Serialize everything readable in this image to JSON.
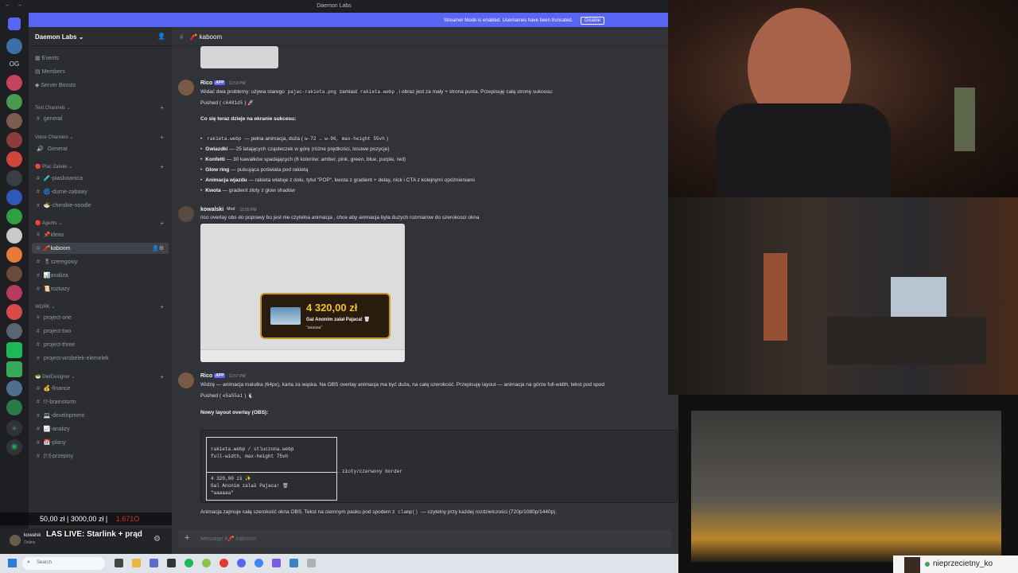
{
  "window": {
    "title": "Daemon Labs",
    "nav": "← →"
  },
  "banner": {
    "text": "Streamer Mode is enabled. Usernames have been truncated.",
    "disable_label": "Disable"
  },
  "rail": {
    "label_og": "OG"
  },
  "sidebar": {
    "guild": "Daemon Labs",
    "items": [
      "Events",
      "Members",
      "Server Boosts"
    ],
    "text_cat": "Text Channels",
    "general": "general",
    "voice_cat": "Voice Channels",
    "voice_general": "General",
    "plac_cat": "Plac Zabaw",
    "plac": [
      "-piaskownica",
      "-durne-zabawy",
      "-chinskie-noodle"
    ],
    "agents_cat": "Agents",
    "agents": [
      "ideas",
      "kaboom",
      "szeregowy",
      "analiza",
      "rozkazy"
    ],
    "work_cat": "WORK",
    "work": [
      "project-one",
      "project-two",
      "project-three",
      "project-wrobelek-elemelek"
    ],
    "diet_cat": "DietDesigner",
    "diet": [
      "-finanse",
      "-brainstorm",
      "-development",
      "-analizy",
      "-plany",
      "-przepisy"
    ]
  },
  "user": {
    "name": "kowalsk",
    "status": "Online"
  },
  "overlay": {
    "donation_a": "50,00 zł",
    "donation_b": "3000,00 zł",
    "donation_c": "1.671O",
    "live": "LAS LIVE: Starlink + prąd",
    "nick": "nieprzecietny_ko"
  },
  "chat": {
    "channel": "kaboom",
    "m1": {
      "author": "Rico",
      "badge": "APP",
      "time": "11:53 PM",
      "l1a": "Widać dwa problemy: używa starego",
      "l1b": "pajac-rakieta.png",
      "l1c": "zamiast",
      "l1d": "rakieta.webp",
      "l1e": ", i obraz jest za mały + strona pusta. Przepisuję całą stronę sukcesu:",
      "l2a": "Pushed (",
      "l2b": "c6481d5",
      "l2c": ") 🚀",
      "heading": "Co się teraz dzieje na ekranie sukcesu:",
      "b1a": "rakieta.webp",
      "b1b": " — pełna animacja, duża (",
      "b1c": "w-72 → w-96, max-height 55vh",
      "b1d": ")",
      "b2a": "Gwiazdki",
      "b2b": " — 25 latających cząsteczek w górę (różne prędkości, losowe pozycje)",
      "b3a": "Konfetti",
      "b3b": " — 30 kawałków spadających (6 kolorów: amber, pink, green, blue, purple, red)",
      "b4a": "Glow ring",
      "b4b": " — pulsująca poświata pod rakietą",
      "b5a": "Animacja wjazdu",
      "b5b": " — rakieta wlatuje z dołu, tytuł \"POP\", kwota z gradient + delay, nick i CTA z kolejnymi opóźnieniami",
      "b6a": "Kwota",
      "b6b": " — gradient złoty z glow shadow"
    },
    "m2": {
      "author": "kowalski",
      "badge": "Mod",
      "time": "11:55 PM",
      "text": "rico overlay obs do poprawy bo jest nie czytelna animacja , chce aby animacja byla duzych rozmiarow do szerokosci okna",
      "alert_amount": "4 320,00 zł",
      "alert_nick": "Gal Anonim zalał Pajaca! 🗑",
      "alert_quote": "\"aaaaaa\""
    },
    "m3": {
      "author": "Rico",
      "badge": "APP",
      "time": "11:57 PM",
      "l1": "Widzę — animacja malutka (64px), karta za wąska. Na OBS overlay animacja ma być duża, na całą szerokość. Przepisuję layout — animacja na górze full-width, tekst pod spod",
      "l2a": "Pushed (",
      "l2b": "e5a55a1",
      "l2c": ") 🐧",
      "heading": "Nowy layout overlay (OBS):",
      "code1": "rakieta.webp / stluczona.webp",
      "code2": "full-width, max-height 75vh",
      "code3": "← złoty/czerwony border",
      "code4": "4 320,00 zł ✨",
      "code5": "Gal Anonim zalał Pajaca! 🗑",
      "code6": "\"aaaaaa\"",
      "foot_a": "Animacja zajmuje całą szerokość okna OBS. Tekst na ciemnym pasku pod spodem z",
      "foot_b": "clamp()",
      "foot_c": "— czytelny przy każdej rozdzielczości (720p/1080p/1440p)."
    },
    "composer_placeholder": "Message #🧨 kaboom"
  },
  "taskbar": {
    "search": "Search"
  },
  "colors": {
    "blurple": "#5865f2",
    "gold": "#f2c230",
    "bg": "#313338"
  }
}
